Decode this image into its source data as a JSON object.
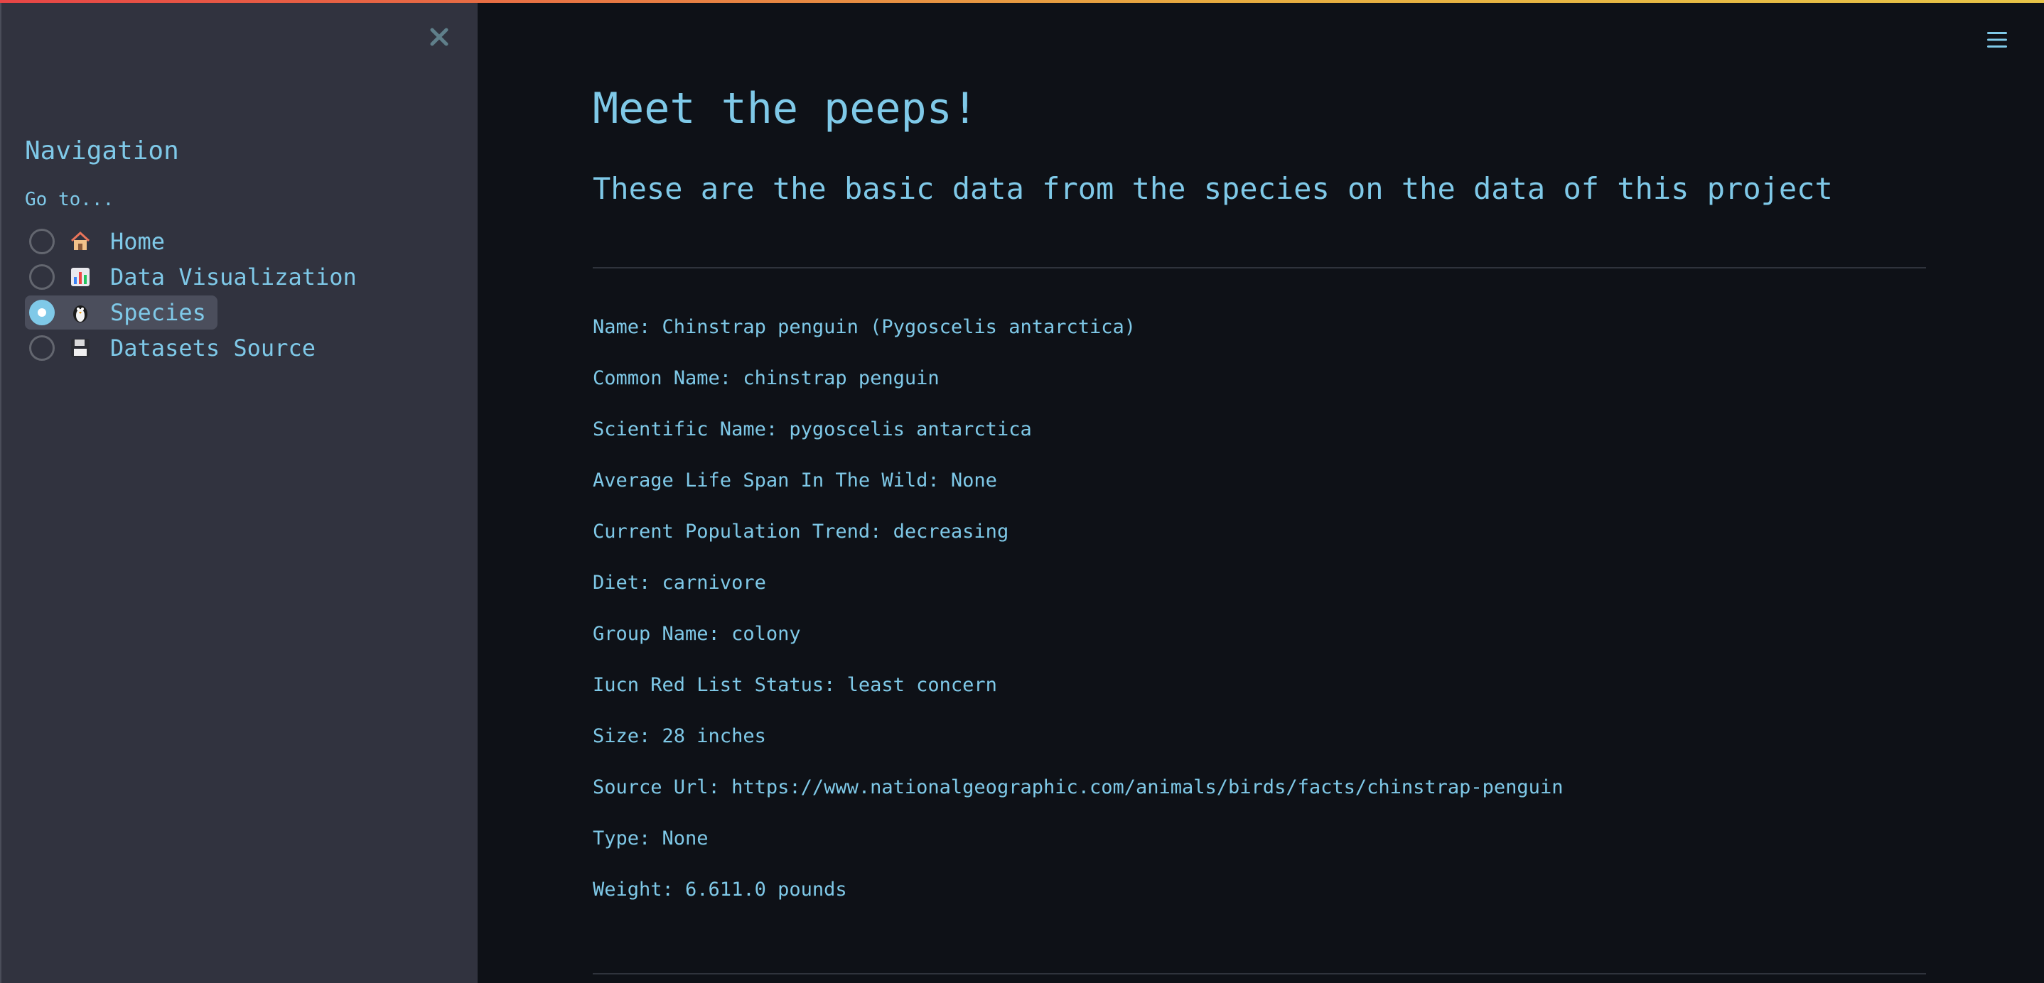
{
  "sidebar": {
    "title": "Navigation",
    "goto_label": "Go to...",
    "items": [
      {
        "emoji": "house-icon",
        "label": "Home",
        "selected": false
      },
      {
        "emoji": "bar-chart-icon",
        "label": "Data Visualization",
        "selected": false
      },
      {
        "emoji": "penguin-icon",
        "label": "Species",
        "selected": true
      },
      {
        "emoji": "floppy-disk-icon",
        "label": "Datasets Source",
        "selected": false
      }
    ]
  },
  "main": {
    "title": "Meet the peeps!",
    "subtitle": "These are the basic data from the species on the data of this project",
    "fields": [
      "Name: Chinstrap penguin (Pygoscelis antarctica)",
      "Common Name: chinstrap penguin",
      "Scientific Name: pygoscelis antarctica",
      "Average Life Span In The Wild: None",
      "Current Population Trend: decreasing",
      "Diet: carnivore",
      "Group Name: colony",
      "Iucn Red List Status: least concern",
      "Size: 28 inches",
      "Source Url: https://www.nationalgeographic.com/animals/birds/facts/chinstrap-penguin",
      "Type: None",
      "Weight: 6.611.0 pounds"
    ]
  },
  "colors": {
    "accent": "#7fc9e8",
    "background": "#0e1117",
    "sidebar": "#31333f"
  }
}
